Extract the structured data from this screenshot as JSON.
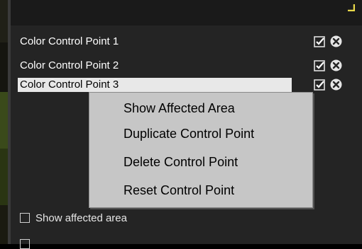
{
  "panel": {
    "control_points": [
      {
        "label": "Color Control Point 1",
        "enabled": true
      },
      {
        "label": "Color Control Point 2",
        "enabled": true
      },
      {
        "label": "Color Control Point 3",
        "enabled": true,
        "selected": true
      }
    ]
  },
  "context_menu": {
    "items": [
      {
        "label": "Show Affected Area"
      },
      {
        "label": "Duplicate Control Point"
      },
      {
        "label": "Delete Control Point"
      },
      {
        "label": "Reset Control Point"
      }
    ]
  },
  "options": {
    "show_affected_area": {
      "label": "Show affected area",
      "checked": false
    }
  },
  "colors": {
    "panel_bg": "#242424",
    "menu_bg": "#c6c6c6",
    "selected_row_bg": "#e8e8e8",
    "accent_corner": "#e8d84a"
  }
}
